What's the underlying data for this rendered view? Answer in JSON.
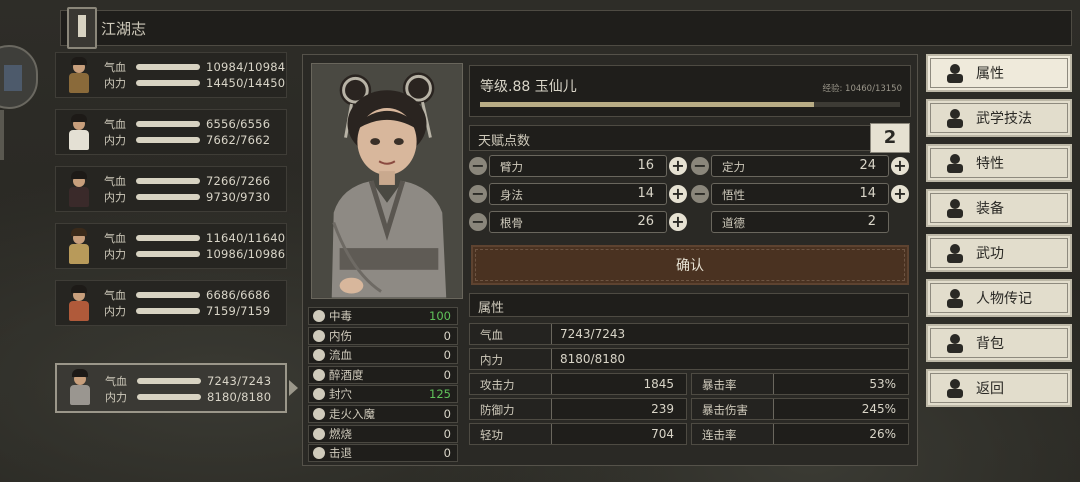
{
  "header": {
    "title": "江湖志"
  },
  "party": [
    {
      "hp_label": "气血",
      "mp_label": "内力",
      "hp": "10984/10984",
      "mp": "14450/14450",
      "colors": {
        "hair": "#1d1a17",
        "robe": "#8a6a3a"
      }
    },
    {
      "hp_label": "气血",
      "mp_label": "内力",
      "hp": "6556/6556",
      "mp": "7662/7662",
      "colors": {
        "hair": "#1d1a17",
        "robe": "#e4e0d4"
      }
    },
    {
      "hp_label": "气血",
      "mp_label": "内力",
      "hp": "7266/7266",
      "mp": "9730/9730",
      "colors": {
        "hair": "#1d1a17",
        "robe": "#3a2a2a"
      }
    },
    {
      "hp_label": "气血",
      "mp_label": "内力",
      "hp": "11640/11640",
      "mp": "10986/10986",
      "colors": {
        "hair": "#3a2a1a",
        "robe": "#b89a5a"
      }
    },
    {
      "hp_label": "气血",
      "mp_label": "内力",
      "hp": "6686/6686",
      "mp": "7159/7159",
      "colors": {
        "hair": "#1d1a17",
        "robe": "#b05a3a"
      }
    },
    {
      "hp_label": "气血",
      "mp_label": "内力",
      "hp": "7243/7243",
      "mp": "8180/8180",
      "colors": {
        "hair": "#1d1a17",
        "robe": "#9a9690"
      },
      "selected": true
    }
  ],
  "statuses": [
    {
      "icon": "skull-icon",
      "name": "中毒",
      "value": "100",
      "green": true
    },
    {
      "icon": "broken-heart-icon",
      "name": "内伤",
      "value": "0"
    },
    {
      "icon": "blood-icon",
      "name": "流血",
      "value": "0"
    },
    {
      "icon": "drunk-icon",
      "name": "醉酒度",
      "value": "0"
    },
    {
      "icon": "acupoint-icon",
      "name": "封穴",
      "value": "125",
      "green": true
    },
    {
      "icon": "qi-deviation-icon",
      "name": "走火入魔",
      "value": "0"
    },
    {
      "icon": "flame-icon",
      "name": "燃烧",
      "value": "0"
    },
    {
      "icon": "knockback-icon",
      "name": "击退",
      "value": "0"
    }
  ],
  "character": {
    "level_text": "等级.88  玉仙儿",
    "exp_text": "经验: 10460/13150",
    "exp_progress": 0.795
  },
  "talent": {
    "label": "天赋点数",
    "points": "2"
  },
  "attributes": [
    {
      "name": "臂力",
      "value": "16",
      "minus": true,
      "plus": true
    },
    {
      "name": "定力",
      "value": "24",
      "minus": true,
      "plus": true
    },
    {
      "name": "身法",
      "value": "14",
      "minus": true,
      "plus": true
    },
    {
      "name": "悟性",
      "value": "14",
      "minus": true,
      "plus": true
    },
    {
      "name": "根骨",
      "value": "26",
      "minus": true,
      "plus": true
    },
    {
      "name": "道德",
      "value": "2",
      "minus": false,
      "plus": false
    }
  ],
  "confirm_label": "确认",
  "properties": {
    "header": "属性",
    "hp": {
      "label": "气血",
      "value": "7243/7243"
    },
    "mp": {
      "label": "内力",
      "value": "8180/8180"
    },
    "pairs": [
      {
        "label": "攻击力",
        "value": "1845"
      },
      {
        "label": "暴击率",
        "value": "53%"
      },
      {
        "label": "防御力",
        "value": "239"
      },
      {
        "label": "暴击伤害",
        "value": "245%"
      },
      {
        "label": "轻功",
        "value": "704"
      },
      {
        "label": "连击率",
        "value": "26%"
      }
    ]
  },
  "menu": [
    {
      "label": "属性",
      "icon": "character-icon",
      "active": true
    },
    {
      "label": "武学技法",
      "icon": "martial-skill-icon"
    },
    {
      "label": "特性",
      "icon": "trait-icon"
    },
    {
      "label": "装备",
      "icon": "sword-icon"
    },
    {
      "label": "武功",
      "icon": "manual-icon"
    },
    {
      "label": "人物传记",
      "icon": "biography-icon"
    },
    {
      "label": "背包",
      "icon": "bag-icon"
    },
    {
      "label": "返回",
      "icon": "door-icon"
    }
  ]
}
